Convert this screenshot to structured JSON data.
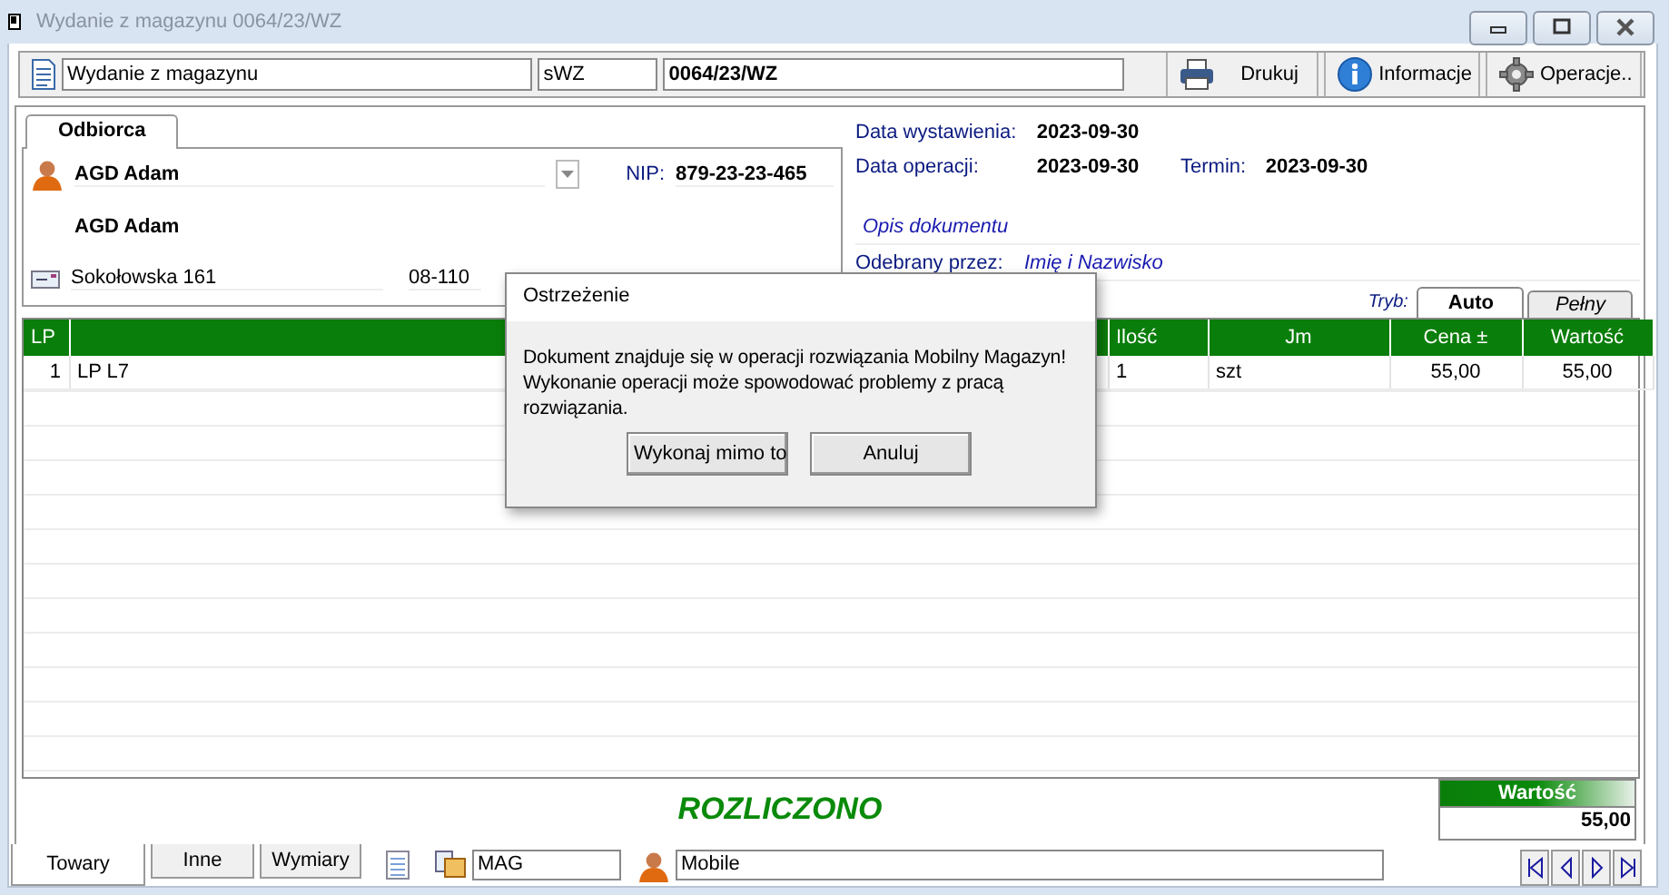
{
  "window": {
    "title": "Wydanie z magazynu 0064/23/WZ"
  },
  "toolbar": {
    "document_type": "Wydanie z magazynu",
    "series": "sWZ",
    "number": "0064/23/WZ",
    "buttons": [
      {
        "label": "Drukuj",
        "kind": "print"
      },
      {
        "label": "Informacje",
        "kind": "info"
      },
      {
        "label": "Operacje..",
        "kind": "gear"
      }
    ]
  },
  "recipient": {
    "tab": "Odbiorca",
    "name": "AGD Adam",
    "nip_label": "NIP:",
    "nip": "879-23-23-465",
    "full_name": "AGD Adam",
    "street": "Sokołowska 161",
    "postal_code": "08-110"
  },
  "dates": {
    "issue_label": "Data wystawienia:",
    "issue": "2023-09-30",
    "operation_label": "Data operacji:",
    "operation": "2023-09-30",
    "due_label": "Termin:",
    "due": "2023-09-30"
  },
  "description": {
    "placeholder": "Opis dokumentu"
  },
  "received_by": {
    "label": "Odebrany przez:",
    "placeholder": "Imię i Nazwisko"
  },
  "mode": {
    "label": "Tryb:",
    "tabs": [
      {
        "label": "Auto",
        "selected": true
      },
      {
        "label": "Pełny",
        "selected": false
      }
    ]
  },
  "table": {
    "columns": [
      "LP",
      "Ilość",
      "Jm",
      "Cena ±",
      "Wartość"
    ],
    "rows": [
      {
        "lp": "1",
        "name": "LP L7",
        "quantity": "1",
        "unit": "szt",
        "price": "55,00",
        "value": "55,00"
      }
    ]
  },
  "status": "ROZLICZONO",
  "total": {
    "label": "Wartość",
    "value": "55,00"
  },
  "bottom_tabs": [
    {
      "label": "Towary",
      "selected": true
    },
    {
      "label": "Inne",
      "selected": false
    },
    {
      "label": "Wymiary",
      "selected": false
    }
  ],
  "warehouse": "MAG",
  "user": "Mobile",
  "dialog": {
    "title": "Ostrzeżenie",
    "message": "Dokument znajduje się w operacji rozwiązania Mobilny Magazyn! Wykonanie operacji może spowodować problemy z pracą rozwiązania.",
    "buttons": [
      "Wykonaj mimo to",
      "Anuluj"
    ]
  }
}
